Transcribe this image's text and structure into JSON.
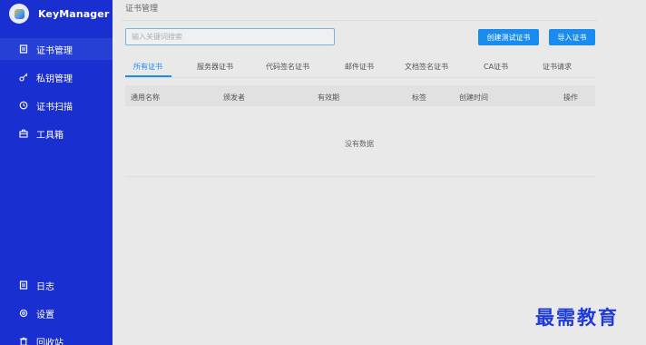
{
  "app": {
    "title": "KeyManager"
  },
  "sidebar": {
    "items": [
      {
        "label": "证书管理",
        "icon": "certificate-icon",
        "active": true
      },
      {
        "label": "私钥管理",
        "icon": "key-icon",
        "active": false
      },
      {
        "label": "证书扫描",
        "icon": "scan-icon",
        "active": false
      },
      {
        "label": "工具箱",
        "icon": "toolbox-icon",
        "active": false
      }
    ],
    "bottom_items": [
      {
        "label": "日志",
        "icon": "log-icon"
      },
      {
        "label": "设置",
        "icon": "gear-icon"
      },
      {
        "label": "回收站",
        "icon": "trash-icon"
      }
    ]
  },
  "page": {
    "title": "证书管理"
  },
  "search": {
    "placeholder": "输入关键词搜索",
    "value": ""
  },
  "toolbar": {
    "create_label": "创建测试证书",
    "import_label": "导入证书"
  },
  "tabs": [
    {
      "label": "所有证书",
      "active": true
    },
    {
      "label": "服务器证书",
      "active": false
    },
    {
      "label": "代码签名证书",
      "active": false
    },
    {
      "label": "邮件证书",
      "active": false
    },
    {
      "label": "文档签名证书",
      "active": false
    },
    {
      "label": "CA证书",
      "active": false
    },
    {
      "label": "证书请求",
      "active": false
    }
  ],
  "table": {
    "columns": [
      "通用名称",
      "颁发者",
      "有效期",
      "标签",
      "创建时间",
      "操作"
    ],
    "empty_text": "没有数据"
  },
  "watermark": {
    "text": "最需教育"
  },
  "colors": {
    "sidebar": "#1a2fcf",
    "accent": "#1a8cf0"
  }
}
